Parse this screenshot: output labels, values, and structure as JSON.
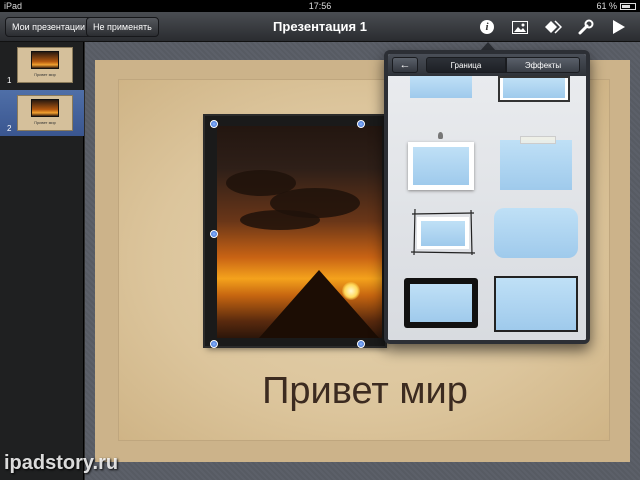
{
  "status_bar": {
    "device": "iPad",
    "time": "17:56",
    "battery": "61 %"
  },
  "toolbar": {
    "my_presentations": "Мои презентации",
    "undo": "Не применять",
    "title": "Презентация 1",
    "icons": [
      "info-icon",
      "media-icon",
      "animation-icon",
      "tools-icon",
      "play-icon"
    ]
  },
  "slides": [
    {
      "number": "1",
      "caption": "Привет мир",
      "selected": false
    },
    {
      "number": "2",
      "caption": "Привет мир",
      "selected": true
    }
  ],
  "slide": {
    "caption": "Привет мир"
  },
  "popover": {
    "back": "←",
    "tabs": [
      {
        "label": "Граница",
        "active": true
      },
      {
        "label": "Эффекты",
        "active": false
      }
    ],
    "frame_styles": [
      "plain-bottom",
      "shadow-frame",
      "pinned-white-frame",
      "taped-frame",
      "sketch-frame",
      "rounded-frame",
      "black-rough-frame",
      "thin-black-frame"
    ]
  },
  "watermark": "ipadstory.ru",
  "colors": {
    "toolbar": "#2a2c30",
    "selection": "#3a5690",
    "slide_paper": "#dcc59c",
    "frame_fill": "#a9d3ef"
  }
}
